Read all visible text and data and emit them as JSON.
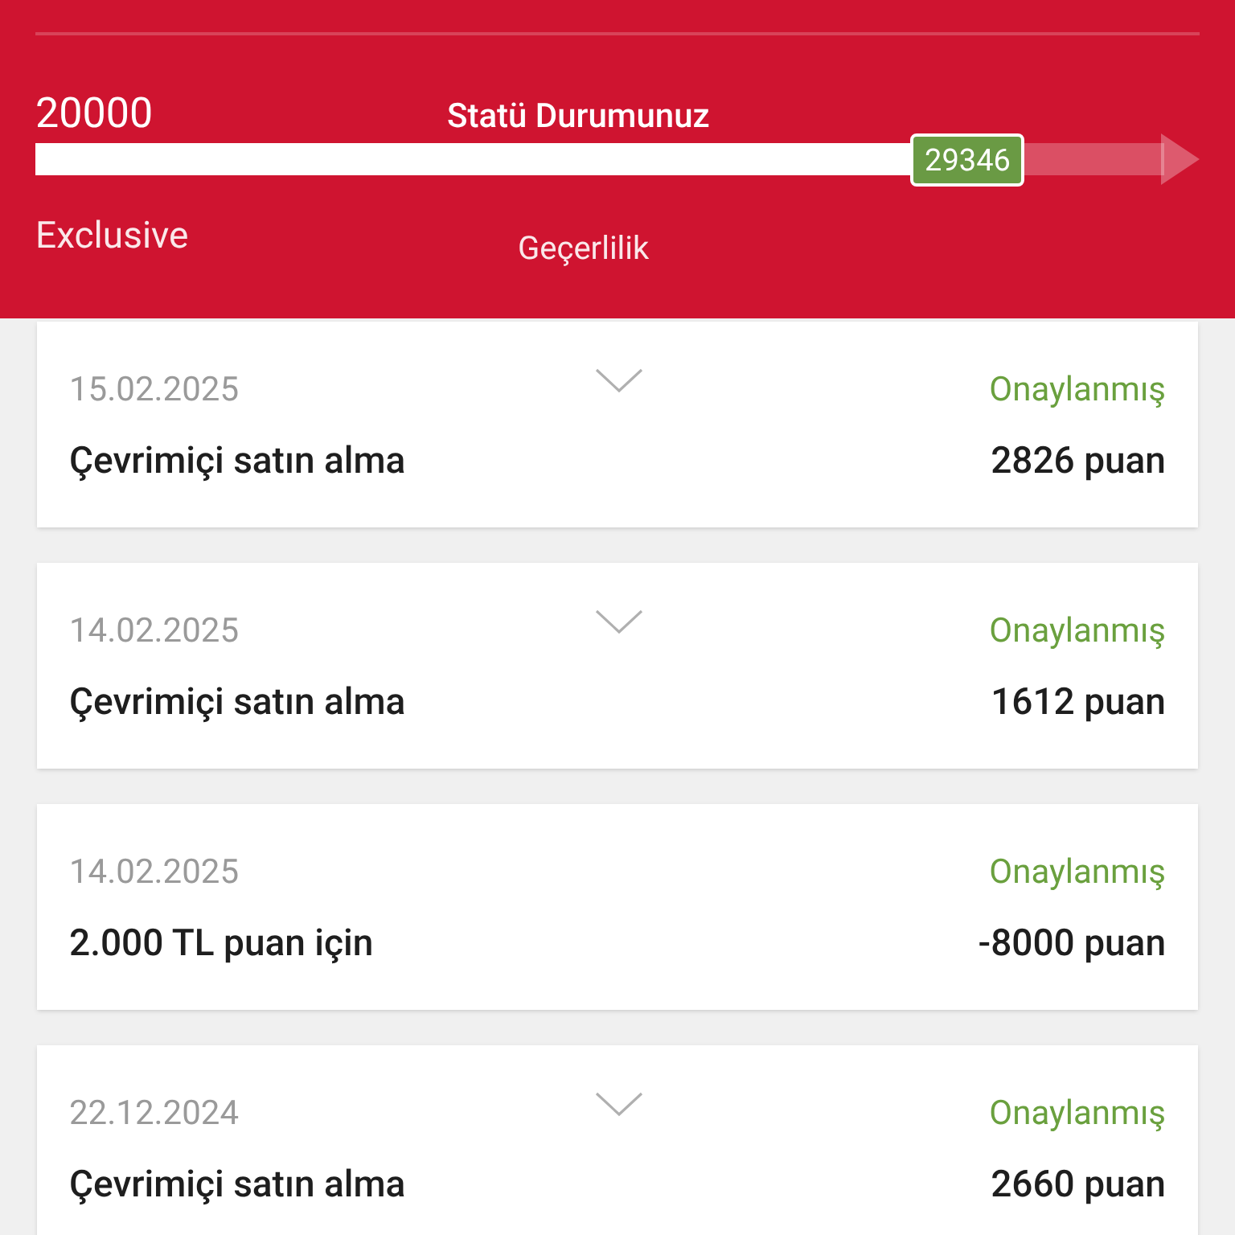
{
  "status": {
    "min_value": "20000",
    "title": "Statü Durumunuz",
    "level": 0.8,
    "current_value": "29346",
    "tier": "Exclusive",
    "validity_label": "Geçerlilik"
  },
  "transactions": [
    {
      "date": "15.02.2025",
      "status": "Onaylanmış",
      "description": "Çevrimiçi satın alma",
      "points": "2826 puan",
      "expandable": true
    },
    {
      "date": "14.02.2025",
      "status": "Onaylanmış",
      "description": "Çevrimiçi satın alma",
      "points": "1612 puan",
      "expandable": true
    },
    {
      "date": "14.02.2025",
      "status": "Onaylanmış",
      "description": "2.000 TL puan için",
      "points": "-8000 puan",
      "expandable": false
    },
    {
      "date": "22.12.2024",
      "status": "Onaylanmış",
      "description": "Çevrimiçi satın alma",
      "points": "2660 puan",
      "expandable": true
    }
  ]
}
